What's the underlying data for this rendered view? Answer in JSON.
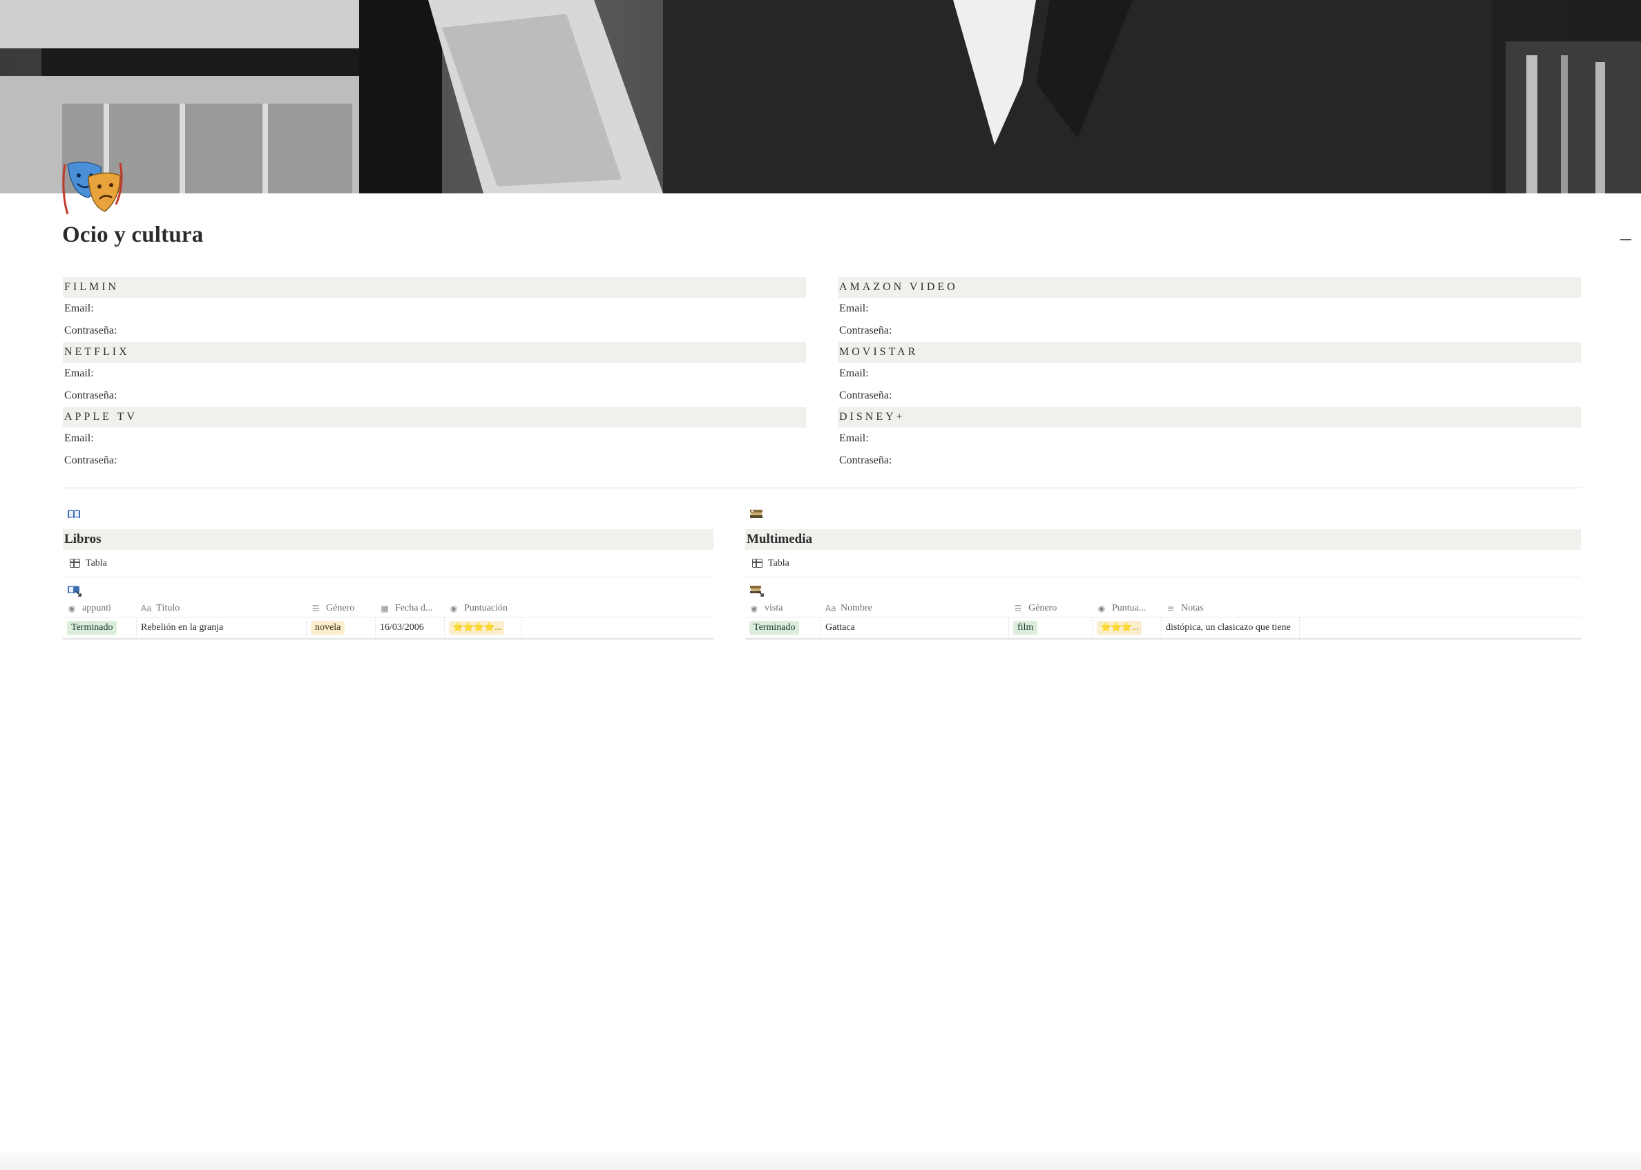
{
  "page": {
    "title": "Ocio y cultura",
    "icon": "theater-masks-icon",
    "cover": "black-and-white photo of a man reading among bookshelves"
  },
  "credentials": {
    "left": [
      {
        "name": "FILMIN",
        "email_label": "Email:",
        "password_label": "Contraseña:"
      },
      {
        "name": "NETFLIX",
        "email_label": "Email:",
        "password_label": "Contraseña:"
      },
      {
        "name": "APPLE TV",
        "email_label": "Email:",
        "password_label": "Contraseña:"
      }
    ],
    "right": [
      {
        "name": "AMAZON VIDEO",
        "email_label": "Email:",
        "password_label": "Contraseña:"
      },
      {
        "name": "MOVISTAR",
        "email_label": "Email:",
        "password_label": "Contraseña:"
      },
      {
        "name": "DISNEY+",
        "email_label": "Email:",
        "password_label": "Contraseña:"
      }
    ]
  },
  "libros": {
    "icon": "open-book-icon",
    "heading": "Libros",
    "view_label": "Tabla",
    "linked_icon": "linked-book-icon",
    "columns": [
      "appunti",
      "Título",
      "Género",
      "Fecha d...",
      "Puntuación"
    ],
    "rows": [
      {
        "status": "Terminado",
        "title": "Rebelión en la granja",
        "genre": "novela",
        "date": "16/03/2006",
        "rating": "⭐⭐⭐⭐..."
      }
    ]
  },
  "multimedia": {
    "icon": "film-stack-icon",
    "heading": "Multimedia",
    "view_label": "Tabla",
    "linked_icon": "linked-film-icon",
    "columns": [
      "vista",
      "Nombre",
      "Género",
      "Puntua...",
      "Notas"
    ],
    "rows": [
      {
        "status": "Terminado",
        "name": "Gattaca",
        "genre": "film",
        "rating": "⭐⭐⭐...",
        "notes": "distópica, un clasicazo que tiene"
      }
    ]
  },
  "colors": {
    "section_bg": "#eef1ec",
    "tag_green": "#dbeddb",
    "tag_yellow": "#fbeecc",
    "text": "#2b2b2b"
  }
}
